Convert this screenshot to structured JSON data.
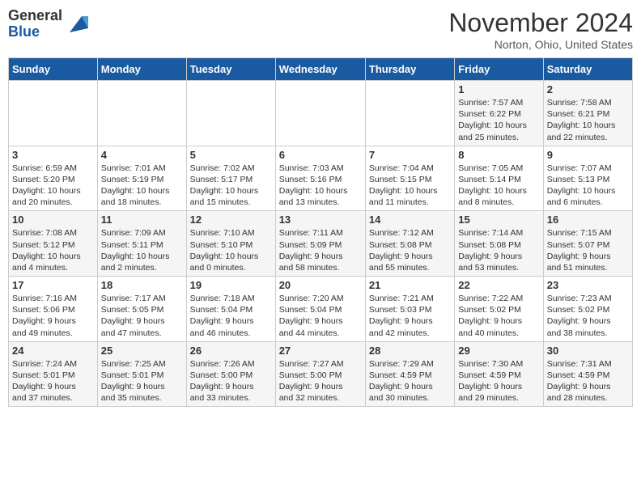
{
  "logo": {
    "general": "General",
    "blue": "Blue"
  },
  "title": "November 2024",
  "location": "Norton, Ohio, United States",
  "days_of_week": [
    "Sunday",
    "Monday",
    "Tuesday",
    "Wednesday",
    "Thursday",
    "Friday",
    "Saturday"
  ],
  "weeks": [
    [
      {
        "day": "",
        "info": ""
      },
      {
        "day": "",
        "info": ""
      },
      {
        "day": "",
        "info": ""
      },
      {
        "day": "",
        "info": ""
      },
      {
        "day": "",
        "info": ""
      },
      {
        "day": "1",
        "info": "Sunrise: 7:57 AM\nSunset: 6:22 PM\nDaylight: 10 hours\nand 25 minutes."
      },
      {
        "day": "2",
        "info": "Sunrise: 7:58 AM\nSunset: 6:21 PM\nDaylight: 10 hours\nand 22 minutes."
      }
    ],
    [
      {
        "day": "3",
        "info": "Sunrise: 6:59 AM\nSunset: 5:20 PM\nDaylight: 10 hours\nand 20 minutes."
      },
      {
        "day": "4",
        "info": "Sunrise: 7:01 AM\nSunset: 5:19 PM\nDaylight: 10 hours\nand 18 minutes."
      },
      {
        "day": "5",
        "info": "Sunrise: 7:02 AM\nSunset: 5:17 PM\nDaylight: 10 hours\nand 15 minutes."
      },
      {
        "day": "6",
        "info": "Sunrise: 7:03 AM\nSunset: 5:16 PM\nDaylight: 10 hours\nand 13 minutes."
      },
      {
        "day": "7",
        "info": "Sunrise: 7:04 AM\nSunset: 5:15 PM\nDaylight: 10 hours\nand 11 minutes."
      },
      {
        "day": "8",
        "info": "Sunrise: 7:05 AM\nSunset: 5:14 PM\nDaylight: 10 hours\nand 8 minutes."
      },
      {
        "day": "9",
        "info": "Sunrise: 7:07 AM\nSunset: 5:13 PM\nDaylight: 10 hours\nand 6 minutes."
      }
    ],
    [
      {
        "day": "10",
        "info": "Sunrise: 7:08 AM\nSunset: 5:12 PM\nDaylight: 10 hours\nand 4 minutes."
      },
      {
        "day": "11",
        "info": "Sunrise: 7:09 AM\nSunset: 5:11 PM\nDaylight: 10 hours\nand 2 minutes."
      },
      {
        "day": "12",
        "info": "Sunrise: 7:10 AM\nSunset: 5:10 PM\nDaylight: 10 hours\nand 0 minutes."
      },
      {
        "day": "13",
        "info": "Sunrise: 7:11 AM\nSunset: 5:09 PM\nDaylight: 9 hours\nand 58 minutes."
      },
      {
        "day": "14",
        "info": "Sunrise: 7:12 AM\nSunset: 5:08 PM\nDaylight: 9 hours\nand 55 minutes."
      },
      {
        "day": "15",
        "info": "Sunrise: 7:14 AM\nSunset: 5:08 PM\nDaylight: 9 hours\nand 53 minutes."
      },
      {
        "day": "16",
        "info": "Sunrise: 7:15 AM\nSunset: 5:07 PM\nDaylight: 9 hours\nand 51 minutes."
      }
    ],
    [
      {
        "day": "17",
        "info": "Sunrise: 7:16 AM\nSunset: 5:06 PM\nDaylight: 9 hours\nand 49 minutes."
      },
      {
        "day": "18",
        "info": "Sunrise: 7:17 AM\nSunset: 5:05 PM\nDaylight: 9 hours\nand 47 minutes."
      },
      {
        "day": "19",
        "info": "Sunrise: 7:18 AM\nSunset: 5:04 PM\nDaylight: 9 hours\nand 46 minutes."
      },
      {
        "day": "20",
        "info": "Sunrise: 7:20 AM\nSunset: 5:04 PM\nDaylight: 9 hours\nand 44 minutes."
      },
      {
        "day": "21",
        "info": "Sunrise: 7:21 AM\nSunset: 5:03 PM\nDaylight: 9 hours\nand 42 minutes."
      },
      {
        "day": "22",
        "info": "Sunrise: 7:22 AM\nSunset: 5:02 PM\nDaylight: 9 hours\nand 40 minutes."
      },
      {
        "day": "23",
        "info": "Sunrise: 7:23 AM\nSunset: 5:02 PM\nDaylight: 9 hours\nand 38 minutes."
      }
    ],
    [
      {
        "day": "24",
        "info": "Sunrise: 7:24 AM\nSunset: 5:01 PM\nDaylight: 9 hours\nand 37 minutes."
      },
      {
        "day": "25",
        "info": "Sunrise: 7:25 AM\nSunset: 5:01 PM\nDaylight: 9 hours\nand 35 minutes."
      },
      {
        "day": "26",
        "info": "Sunrise: 7:26 AM\nSunset: 5:00 PM\nDaylight: 9 hours\nand 33 minutes."
      },
      {
        "day": "27",
        "info": "Sunrise: 7:27 AM\nSunset: 5:00 PM\nDaylight: 9 hours\nand 32 minutes."
      },
      {
        "day": "28",
        "info": "Sunrise: 7:29 AM\nSunset: 4:59 PM\nDaylight: 9 hours\nand 30 minutes."
      },
      {
        "day": "29",
        "info": "Sunrise: 7:30 AM\nSunset: 4:59 PM\nDaylight: 9 hours\nand 29 minutes."
      },
      {
        "day": "30",
        "info": "Sunrise: 7:31 AM\nSunset: 4:59 PM\nDaylight: 9 hours\nand 28 minutes."
      }
    ]
  ]
}
